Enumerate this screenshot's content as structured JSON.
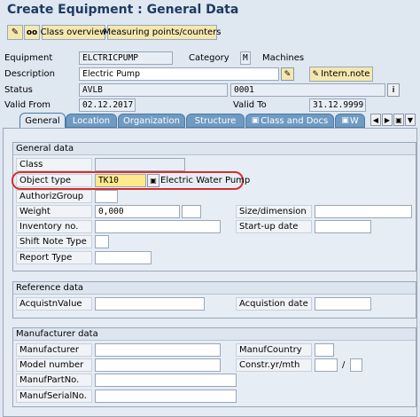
{
  "window": {
    "title": "Create Equipment : General Data"
  },
  "toolbar": {
    "class_overview": "Class overview",
    "measuring_points": "Measuring points/counters"
  },
  "header": {
    "equipment_label": "Equipment",
    "equipment_value": "ELCTRICPUMP",
    "category_label": "Category",
    "category_value": "M",
    "category_text": "Machines",
    "description_label": "Description",
    "description_value": "Electric Pump",
    "intern_note": "Intern.note",
    "status_label": "Status",
    "status_value": "AVLB",
    "status_value2": "0001",
    "valid_from_label": "Valid From",
    "valid_from_value": "02.12.2017",
    "valid_to_label": "Valid To",
    "valid_to_value": "31.12.9999"
  },
  "tabs": [
    {
      "label": "General"
    },
    {
      "label": "Location"
    },
    {
      "label": "Organization"
    },
    {
      "label": "Structure"
    },
    {
      "label": "Class and Docs"
    },
    {
      "label": "W"
    }
  ],
  "general": {
    "title": "General data",
    "class_label": "Class",
    "object_type_label": "Object type",
    "object_type_value": "TK10",
    "object_type_text": "Electric Water Pump",
    "authoriz_label": "AuthorizGroup",
    "weight_label": "Weight",
    "weight_value": "0,000",
    "size_label": "Size/dimension",
    "inventory_label": "Inventory no.",
    "startup_label": "Start-up date",
    "shift_label": "Shift Note Type",
    "report_label": "Report Type"
  },
  "reference": {
    "title": "Reference data",
    "acq_value_label": "AcquistnValue",
    "acq_date_label": "Acquistion date"
  },
  "manufacturer": {
    "title": "Manufacturer data",
    "manufacturer_label": "Manufacturer",
    "country_label": "ManufCountry",
    "model_label": "Model number",
    "constr_label": "Constr.yr/mth",
    "constr_sep": "/",
    "partno_label": "ManufPartNo.",
    "serial_label": "ManufSerialNo."
  },
  "colors": {
    "accent": "#d32f2f",
    "tab": "#6f9bc3",
    "title": "#1d3b62"
  }
}
